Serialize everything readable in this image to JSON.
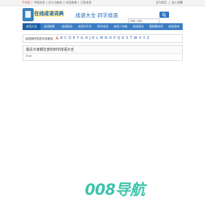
{
  "topbar": {
    "links": [
      "手机版",
      "中国成语",
      "近义词查询",
      "成语故事",
      "万条成语"
    ],
    "right": [
      "设为首页",
      "加入收藏"
    ]
  },
  "header": {
    "logo_text": "在线成语词典",
    "brand": "成语大全 四字成语",
    "search_placeholder": "请输入成语"
  },
  "nav": {
    "items": [
      "成语大全",
      "成语故事",
      "成语接龙",
      "成语字开头",
      "四字成语",
      "成语二年级",
      "成语接龙",
      "看图猜成语",
      "成语游戏"
    ]
  },
  "alphabet": {
    "label": "成语按拼音首字母查找:",
    "letters": [
      "A",
      "B",
      "C",
      "D",
      "E",
      "F",
      "G",
      "H",
      "J",
      "K",
      "L",
      "M",
      "N",
      "O",
      "P",
      "Q",
      "R",
      "S",
      "T",
      "W",
      "X",
      "Y",
      "Z"
    ]
  },
  "result": {
    "title": "最近大家都在查的四字成语大全",
    "body": "Error"
  },
  "watermark": {
    "text": "008导航"
  },
  "colors": {
    "nav": "#3b7dc4",
    "nav_active": "#1d5ea6",
    "link": "#1e5ea8",
    "watermark": "#3ec4ad"
  }
}
